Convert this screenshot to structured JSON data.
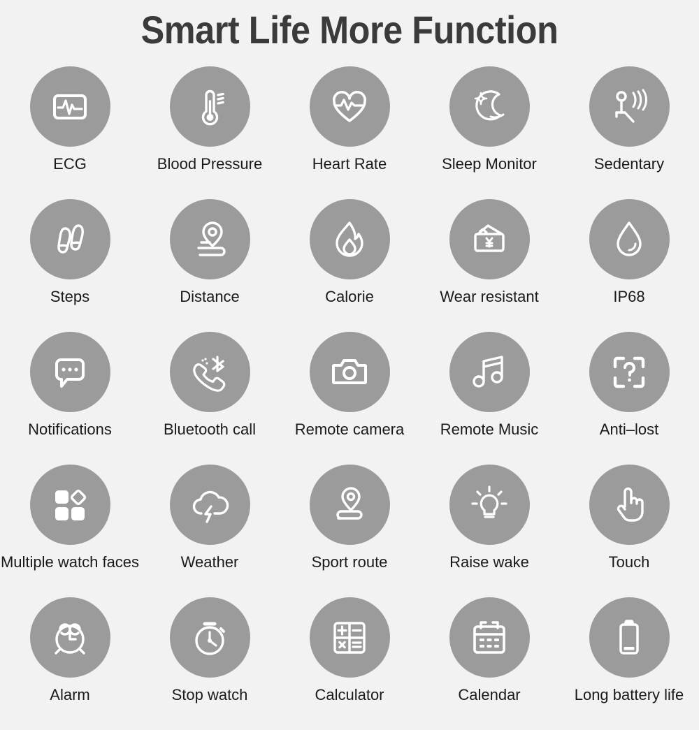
{
  "header": {
    "title": "Smart Life More Function"
  },
  "theme": {
    "background": "#f2f2f2",
    "circle_fill": "#9b9b9b",
    "icon_stroke": "#ffffff",
    "label_color": "#1a1a1a",
    "title_color": "#3b3b3b"
  },
  "grid": {
    "columns": 5,
    "rows": 5,
    "items": [
      {
        "label": "ECG",
        "icon": "ecg-icon"
      },
      {
        "label": "Blood Pressure",
        "icon": "thermometer-icon"
      },
      {
        "label": "Heart Rate",
        "icon": "heart-pulse-icon"
      },
      {
        "label": "Sleep Monitor",
        "icon": "moon-star-icon"
      },
      {
        "label": "Sedentary",
        "icon": "seated-person-vibration-icon"
      },
      {
        "label": "Steps",
        "icon": "footprints-icon"
      },
      {
        "label": "Distance",
        "icon": "map-pin-road-icon"
      },
      {
        "label": "Calorie",
        "icon": "flame-icon"
      },
      {
        "label": "Wear resistant",
        "icon": "wallet-yen-icon"
      },
      {
        "label": "IP68",
        "icon": "water-drop-icon"
      },
      {
        "label": "Notifications",
        "icon": "speech-bubble-dots-icon"
      },
      {
        "label": "Bluetooth call",
        "icon": "phone-bluetooth-icon"
      },
      {
        "label": "Remote camera",
        "icon": "camera-icon"
      },
      {
        "label": "Remote Music",
        "icon": "music-note-icon"
      },
      {
        "label": "Anti–lost",
        "icon": "question-scan-icon"
      },
      {
        "label": "Multiple watch faces",
        "icon": "watch-faces-grid-icon"
      },
      {
        "label": "Weather",
        "icon": "cloud-lightning-icon"
      },
      {
        "label": "Sport route",
        "icon": "route-pin-icon"
      },
      {
        "label": "Raise wake",
        "icon": "lightbulb-icon"
      },
      {
        "label": "Touch",
        "icon": "pointing-hand-icon"
      },
      {
        "label": "Alarm",
        "icon": "alarm-clock-icon"
      },
      {
        "label": "Stop watch",
        "icon": "stopwatch-icon"
      },
      {
        "label": "Calculator",
        "icon": "calculator-icon"
      },
      {
        "label": "Calendar",
        "icon": "calendar-icon"
      },
      {
        "label": "Long battery life",
        "icon": "battery-icon"
      }
    ]
  }
}
